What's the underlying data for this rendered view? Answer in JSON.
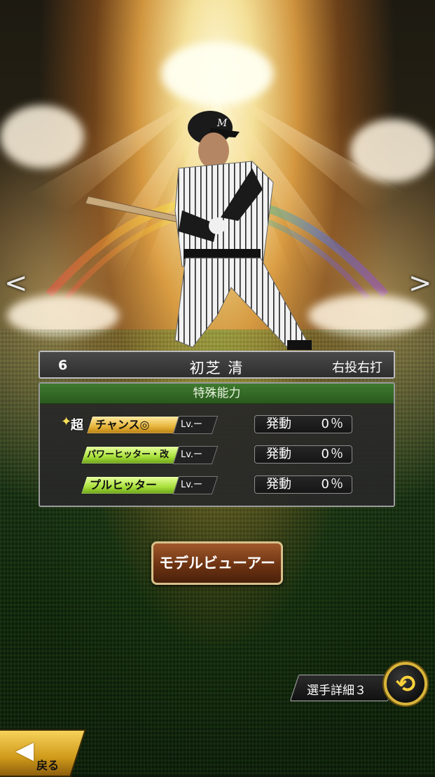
{
  "player": {
    "number": "6",
    "name": "初芝 清",
    "handedness": "右投右打"
  },
  "abilities": {
    "header": "特殊能力",
    "items": [
      {
        "prefix": "超",
        "name": "チャンス◎",
        "level": "Lv.ー",
        "trigger_label": "発動",
        "trigger_value": "0％",
        "style": "gold"
      },
      {
        "prefix": "",
        "name": "パワーヒッター・改",
        "level": "Lv.ー",
        "trigger_label": "発動",
        "trigger_value": "0％",
        "style": "green"
      },
      {
        "prefix": "",
        "name": "プルヒッター",
        "level": "Lv.ー",
        "trigger_label": "発動",
        "trigger_value": "0％",
        "style": "green"
      }
    ]
  },
  "buttons": {
    "model_viewer": "モデルビューアー",
    "player_detail": "選手詳細３",
    "back": "戻る"
  },
  "icons": {
    "prev": "chevron-left-icon",
    "next": "chevron-right-icon",
    "swap": "swap-icon",
    "back": "back-arrow-icon"
  },
  "colors": {
    "ability_header": "#2f6b22",
    "gold_chip": "#e7b53a",
    "green_chip": "#a8e03a",
    "model_button": "#6e3413",
    "swap_ring": "#d9b53a"
  }
}
